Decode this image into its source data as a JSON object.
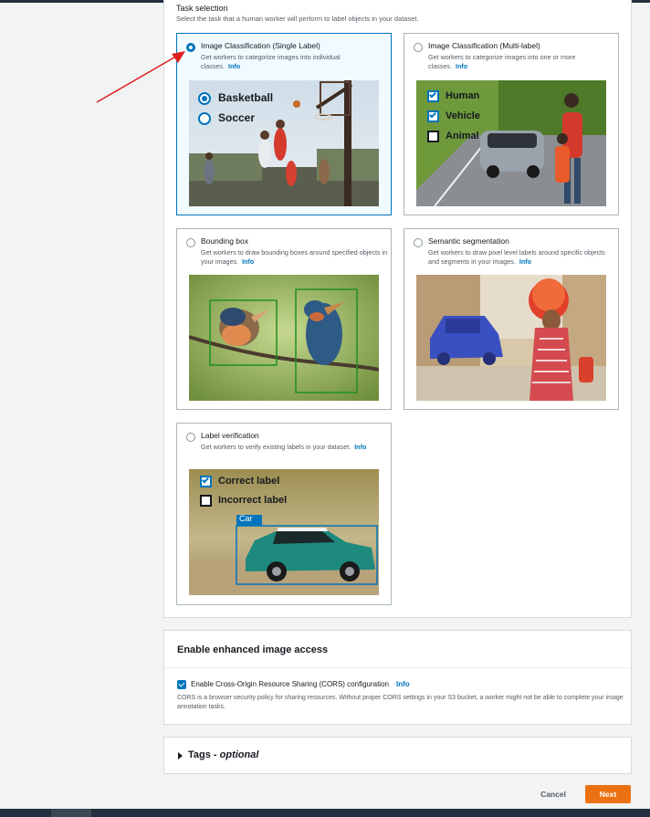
{
  "task_selection": {
    "title": "Task selection",
    "description": "Select the task that a human worker will perform to label objects in your dataset.",
    "info_label": "Info",
    "cards": [
      {
        "title": "Image Classification (Single Label)",
        "description": "Get workers to categorize images into individual classes.",
        "selected": true,
        "image_labels": [
          "Basketball",
          "Soccer"
        ]
      },
      {
        "title": "Image Classification (Multi-label)",
        "description": "Get workers to categorize images into one or more classes.",
        "selected": false,
        "image_labels": [
          "Human",
          "Vehicle",
          "Animal"
        ]
      },
      {
        "title": "Bounding box",
        "description": "Get workers to draw bounding boxes around specified objects in your images.",
        "selected": false
      },
      {
        "title": "Semantic segmentation",
        "description": "Get workers to draw pixel level labels around specific objects and segments in your images.",
        "selected": false
      },
      {
        "title": "Label verification",
        "description": "Get workers to verify existing labels in your dataset.",
        "selected": false,
        "image_labels": [
          "Correct label",
          "Incorrect label",
          "Car"
        ]
      }
    ]
  },
  "enhanced_access": {
    "heading": "Enable enhanced image access",
    "checkbox_label": "Enable Cross-Origin Resource Sharing (CORS) configuration",
    "checked": true,
    "info_label": "Info",
    "description": "CORS is a browser security policy for sharing resources. Without proper CORS settings in your S3 bucket, a worker might not be able to complete your image annotation tasks."
  },
  "tags": {
    "label": "Tags",
    "optional": "- optional"
  },
  "footer": {
    "cancel": "Cancel",
    "next": "Next"
  },
  "colors": {
    "accent": "#0073bb",
    "primary_button": "#ec7211",
    "annotation_arrow": "#e02020"
  }
}
